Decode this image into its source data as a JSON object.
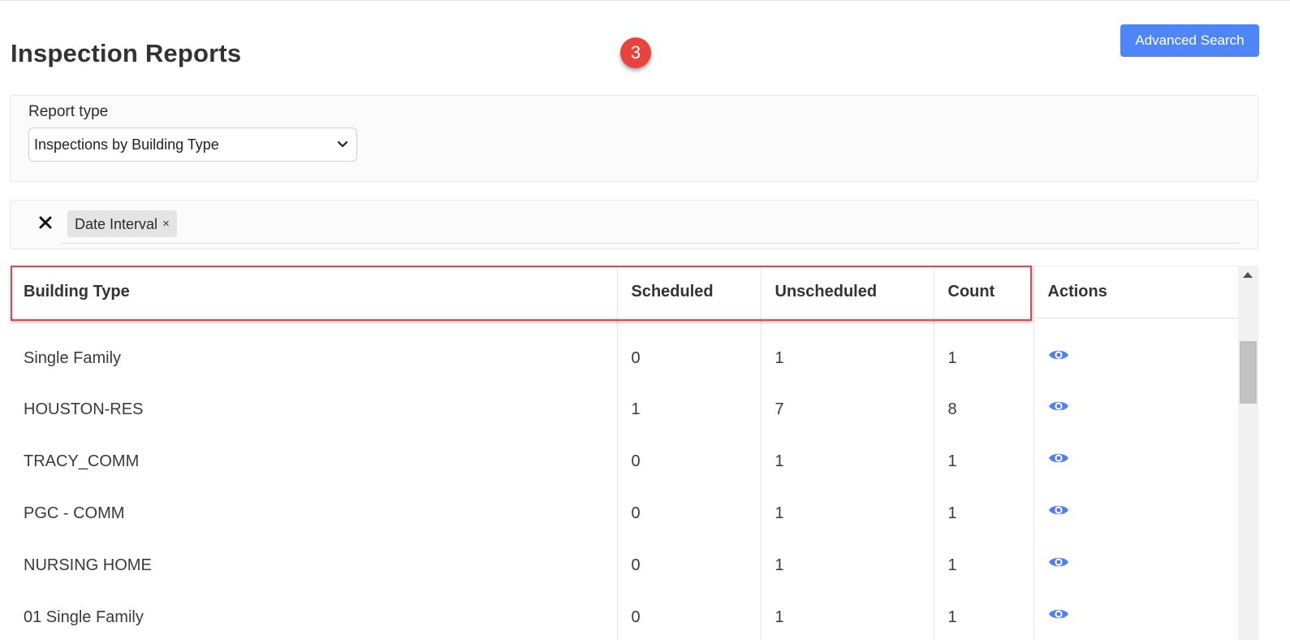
{
  "page": {
    "title": "Inspection Reports",
    "step_badge": "3"
  },
  "toolbar": {
    "advanced_search_label": "Advanced Search"
  },
  "report": {
    "label": "Report type",
    "selected": "Inspections by Building Type"
  },
  "filters": {
    "chips": [
      {
        "label": "Date Interval",
        "remove": "×"
      }
    ]
  },
  "table": {
    "headers": [
      "Building Type",
      "Scheduled",
      "Unscheduled",
      "Count",
      "Actions"
    ],
    "rows": [
      {
        "building_type": "Single Family",
        "scheduled": "0",
        "unscheduled": "1",
        "count": "1"
      },
      {
        "building_type": "HOUSTON-RES",
        "scheduled": "1",
        "unscheduled": "7",
        "count": "8"
      },
      {
        "building_type": "TRACY_COMM",
        "scheduled": "0",
        "unscheduled": "1",
        "count": "1"
      },
      {
        "building_type": "PGC - COMM",
        "scheduled": "0",
        "unscheduled": "1",
        "count": "1"
      },
      {
        "building_type": "NURSING HOME",
        "scheduled": "0",
        "unscheduled": "1",
        "count": "1"
      },
      {
        "building_type": "01 Single Family",
        "scheduled": "0",
        "unscheduled": "1",
        "count": "1"
      }
    ]
  },
  "colors": {
    "accent": "#4f86f7",
    "highlight": "#e4454a",
    "badge": "#e8433f"
  },
  "icons": {
    "view": "eye-icon",
    "clear": "close-icon",
    "select": "chevron-down-icon"
  }
}
